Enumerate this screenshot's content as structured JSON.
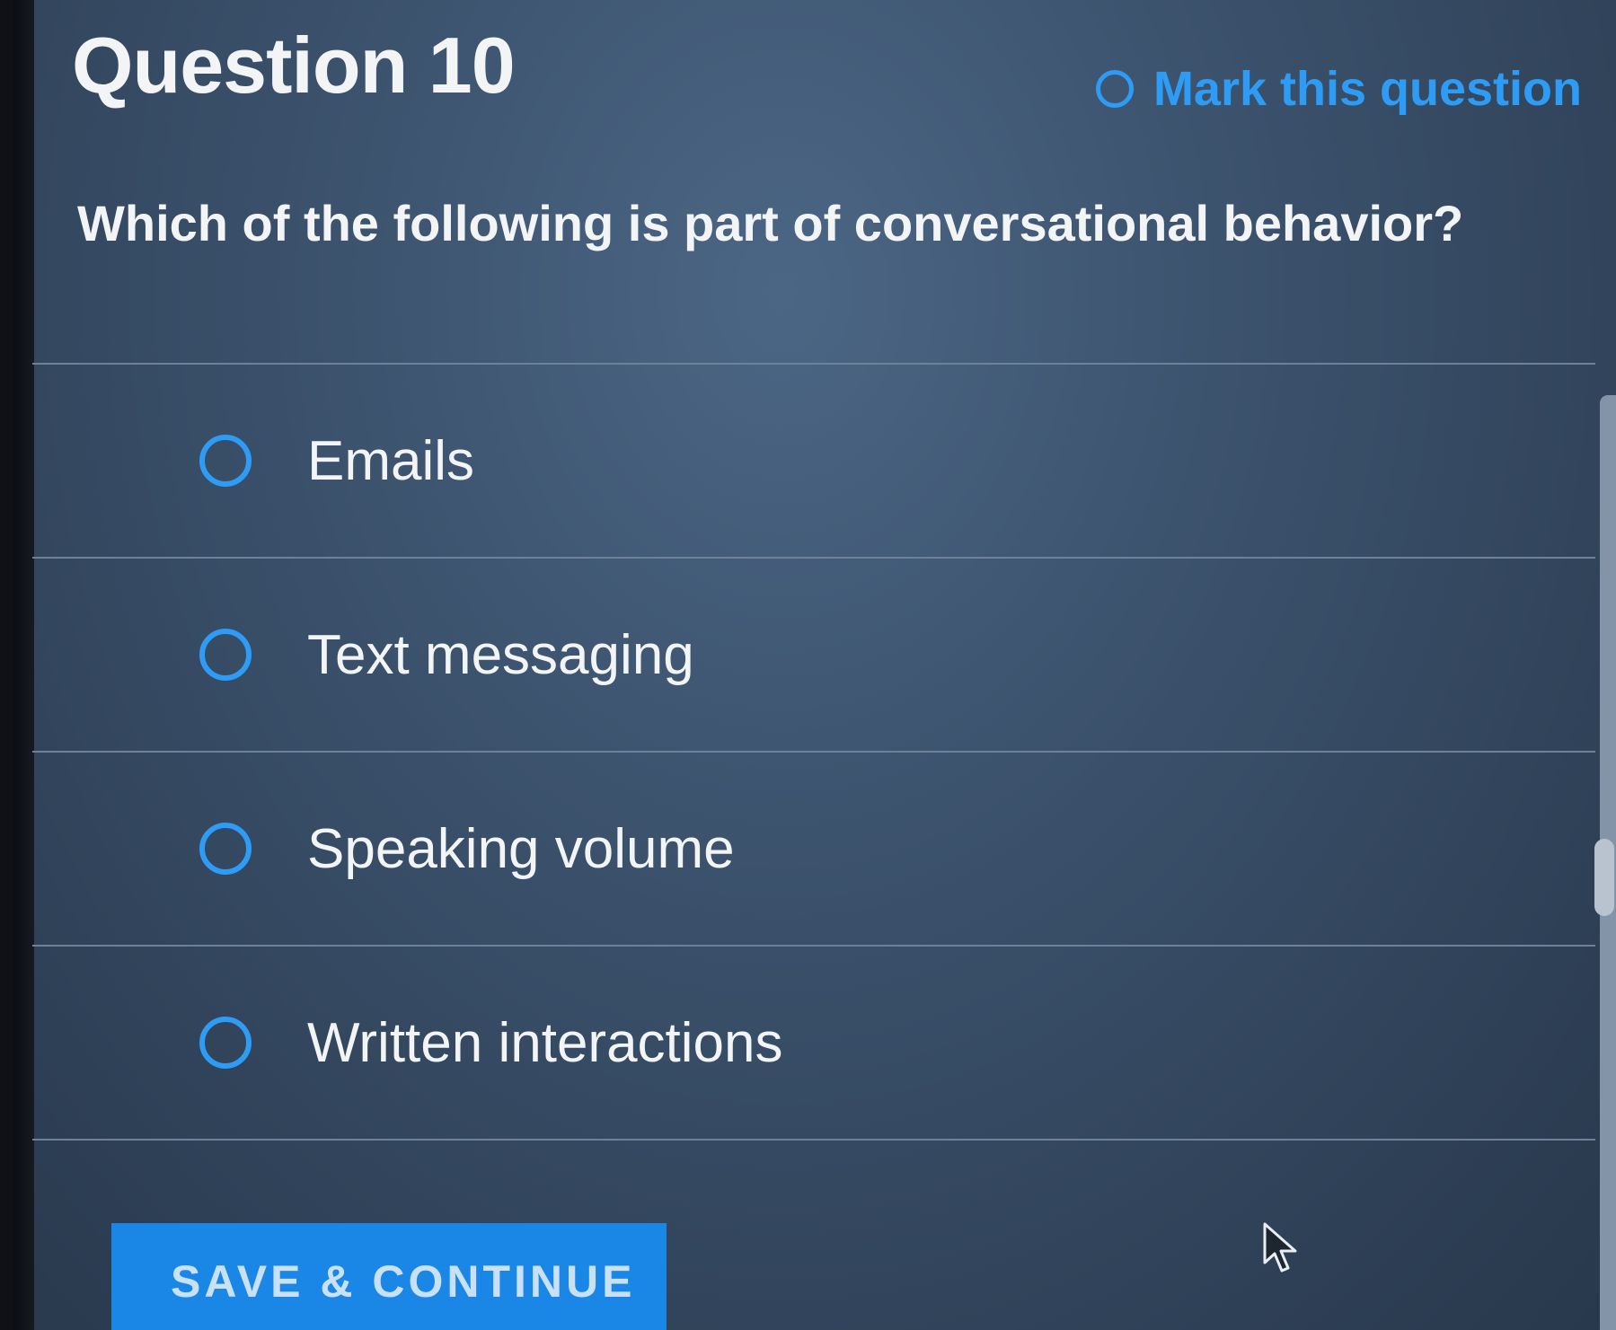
{
  "question": {
    "title": "Question 10",
    "text": "Which of the following is part of conversational behavior?"
  },
  "mark_question": {
    "label": "Mark this question",
    "icon": "radio-empty-icon"
  },
  "options": [
    {
      "label": "Emails",
      "selected": false
    },
    {
      "label": "Text messaging",
      "selected": false
    },
    {
      "label": "Speaking volume",
      "selected": false
    },
    {
      "label": "Written interactions",
      "selected": false
    }
  ],
  "actions": {
    "save_continue_label": "SAVE & CONTINUE"
  },
  "colors": {
    "accent": "#2e9cf5",
    "button": "#1a86e6",
    "text": "#f2f4f6"
  },
  "cursor": {
    "icon": "mouse-pointer-icon"
  }
}
